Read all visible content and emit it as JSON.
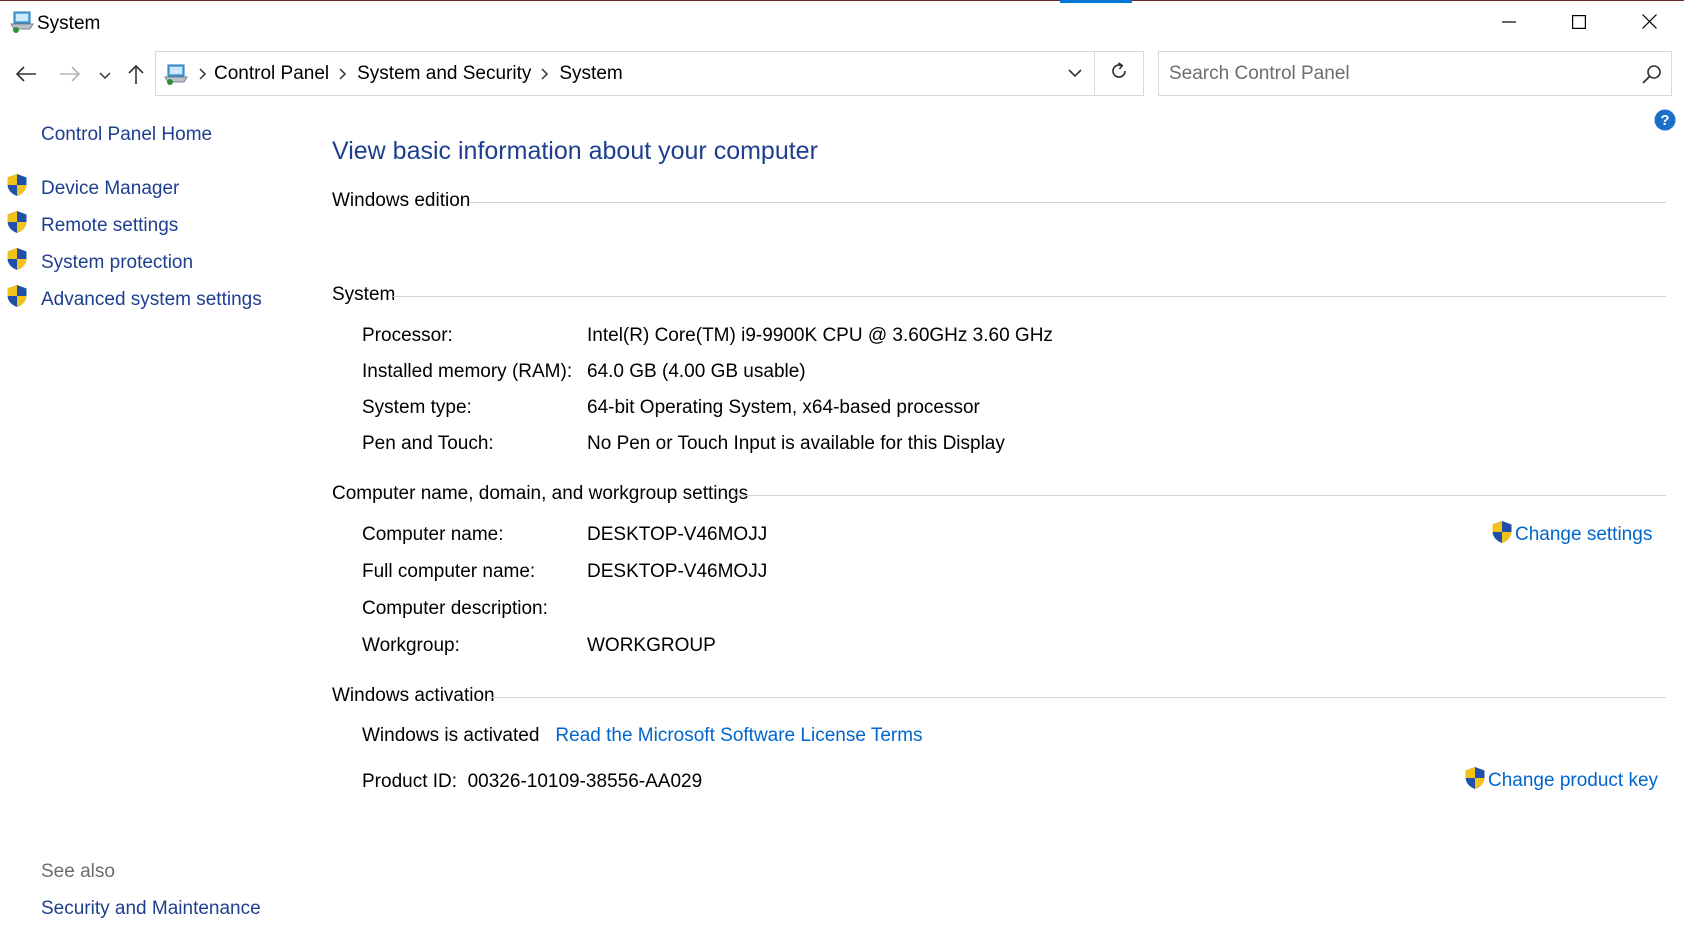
{
  "window": {
    "title": "System",
    "minimize_label": "Minimize",
    "maximize_label": "Maximize",
    "close_label": "Close"
  },
  "address_bar": {
    "breadcrumbs": [
      "Control Panel",
      "System and Security",
      "System"
    ]
  },
  "search": {
    "placeholder": "Search Control Panel",
    "value": ""
  },
  "sidebar": {
    "home_label": "Control Panel Home",
    "items": [
      {
        "label": "Device Manager",
        "icon": "uac-shield-icon"
      },
      {
        "label": "Remote settings",
        "icon": "uac-shield-icon"
      },
      {
        "label": "System protection",
        "icon": "uac-shield-icon"
      },
      {
        "label": "Advanced system settings",
        "icon": "uac-shield-icon"
      }
    ],
    "see_also_label": "See also",
    "see_also_links": [
      "Security and Maintenance"
    ]
  },
  "main": {
    "title": "View basic information about your computer",
    "windows_edition": {
      "heading": "Windows edition"
    },
    "system": {
      "heading": "System",
      "rows": [
        {
          "label": "Processor:",
          "value": "Intel(R) Core(TM) i9-9900K CPU @ 3.60GHz   3.60 GHz"
        },
        {
          "label": "Installed memory (RAM):",
          "value": "64.0 GB (4.00 GB usable)"
        },
        {
          "label": "System type:",
          "value": "64-bit Operating System, x64-based processor"
        },
        {
          "label": "Pen and Touch:",
          "value": "No Pen or Touch Input is available for this Display"
        }
      ]
    },
    "computer_name": {
      "heading": "Computer name, domain, and workgroup settings",
      "change_settings_label": "Change settings",
      "rows": [
        {
          "label": "Computer name:",
          "value": "DESKTOP-V46MOJJ"
        },
        {
          "label": "Full computer name:",
          "value": "DESKTOP-V46MOJJ"
        },
        {
          "label": "Computer description:",
          "value": ""
        },
        {
          "label": "Workgroup:",
          "value": "WORKGROUP"
        }
      ]
    },
    "activation": {
      "heading": "Windows activation",
      "status": "Windows is activated",
      "license_link": "Read the Microsoft Software License Terms",
      "product_id_label": "Product ID:",
      "product_id": "00326-10109-38556-AA029",
      "change_key_label": "Change product key"
    }
  },
  "colors": {
    "title_blue": "#1e3f8f",
    "link_blue": "#0066cc",
    "section_line": "#d4d4d4",
    "muted_text": "#6d6d6d"
  }
}
